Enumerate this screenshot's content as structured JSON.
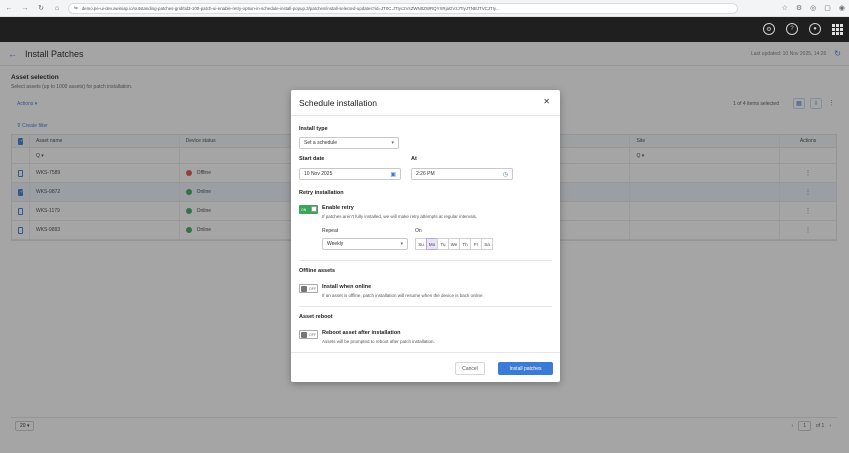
{
  "browser": {
    "url": "demo.pe-ui-dev.awiniap.io/outstanding-patches-grid/tid3-100-patch-ui-enable-retry-option-in-schedule-install-popup.3/patches/install-selected-updates?id=JT0C.JTIyc2VsZWN0ZWRQYXRjaGVzJTIyJTNBJTVCJTIy..."
  },
  "header": {
    "title": "Install Patches",
    "last_updated": "Last updated: 10 Nov 2025, 14:26"
  },
  "background": {
    "section_title": "Asset selection",
    "section_subtitle": "Select assets (up to 1000 assets) for patch installation.",
    "actions_label": "Actions",
    "create_filter": "Create filter",
    "items_selected": "1 of 4 items selected",
    "columns": [
      "Asset name",
      "Device status",
      "",
      "Site",
      "Actions"
    ],
    "filter_placeholder": "Q",
    "rows": [
      {
        "name": "WKS-7589",
        "status": "Offline",
        "checked": false
      },
      {
        "name": "WKS-9872",
        "status": "Online",
        "checked": true
      },
      {
        "name": "WKS-1179",
        "status": "Online",
        "checked": false
      },
      {
        "name": "WKS-9893",
        "status": "Online",
        "checked": false
      }
    ],
    "page_size": "20",
    "page_current": "1",
    "page_total": "of 1"
  },
  "modal": {
    "title": "Schedule installation",
    "install_type_label": "Install type",
    "install_type_value": "Set a schedule",
    "start_date_label": "Start date",
    "start_date_value": "10 Nov 2025",
    "at_label": "At",
    "at_value": "2:26 PM",
    "retry_label": "Retry installation",
    "retry_toggle": "ON",
    "retry_title": "Enable retry",
    "retry_desc": "If patches aren't fully installed, we will make retry attempts at regular intervals.",
    "repeat_label": "Repeat",
    "repeat_value": "Weekly",
    "on_label": "On",
    "days": [
      "Su",
      "Mo",
      "Tu",
      "We",
      "Th",
      "Fr",
      "Sa"
    ],
    "offline_label": "Offline assets",
    "offline_toggle": "OFF",
    "offline_title": "Install when online",
    "offline_desc": "If an asset is offline, patch installation will resume when the device is back online.",
    "reboot_label": "Asset reboot",
    "reboot_toggle": "OFF",
    "reboot_title": "Reboot asset after installation",
    "reboot_desc": "Assets will be prompted to reboot after patch installation.",
    "cancel_label": "Cancel",
    "install_label": "Install patches"
  }
}
